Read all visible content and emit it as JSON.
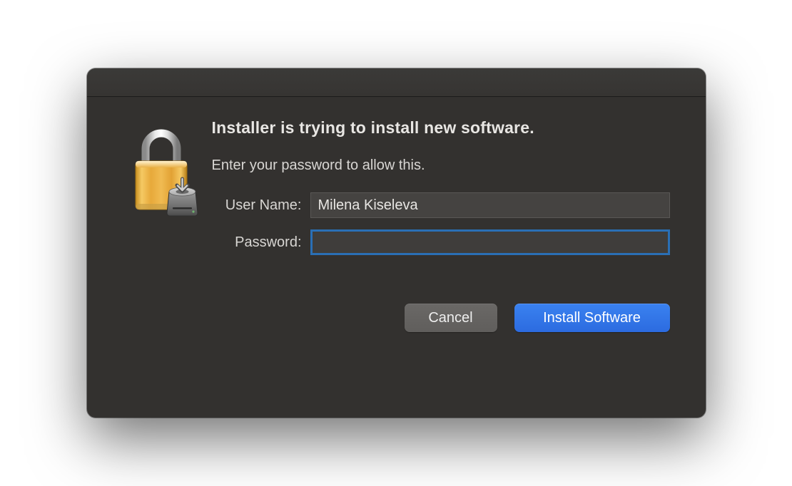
{
  "dialog": {
    "title": "Installer is trying to install new software.",
    "subtitle": "Enter your password to allow this.",
    "fields": {
      "username_label": "User Name:",
      "username_value": "Milena Kiseleva",
      "password_label": "Password:",
      "password_value": ""
    },
    "buttons": {
      "cancel": "Cancel",
      "confirm": "Install Software"
    }
  },
  "icons": {
    "lock": "lock-icon",
    "drive_overlay": "drive-download-icon"
  },
  "colors": {
    "dialog_bg": "#33312f",
    "input_bg": "#454341",
    "focus_ring": "#2a6fb5",
    "primary_btn": "#2c6be0",
    "secondary_btn": "#605e5c",
    "text": "#e8e6e3"
  }
}
